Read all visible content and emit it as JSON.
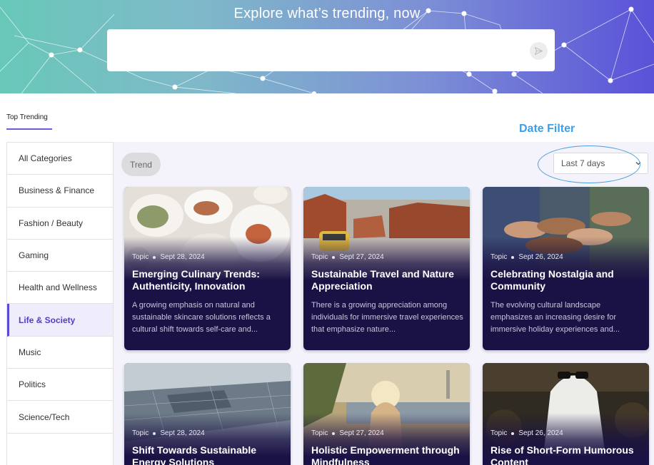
{
  "hero": {
    "title": "Explore what’s trending, now",
    "search_placeholder": "",
    "send_icon": "send-icon"
  },
  "tabs": {
    "top_trending": "Top Trending"
  },
  "annotation": {
    "date_filter": "Date Filter"
  },
  "sidebar": {
    "items": [
      {
        "label": "All Categories"
      },
      {
        "label": "Business & Finance"
      },
      {
        "label": "Fashion / Beauty"
      },
      {
        "label": "Gaming"
      },
      {
        "label": "Health and Wellness"
      },
      {
        "label": "Life & Society",
        "active": true
      },
      {
        "label": "Music"
      },
      {
        "label": "Politics"
      },
      {
        "label": "Science/Tech"
      }
    ]
  },
  "filters": {
    "chip": "Trend",
    "date_selected": "Last 7 days"
  },
  "cards": [
    {
      "topic": "Topic",
      "date": "Sept 28, 2024",
      "title": "Emerging Culinary Trends: Authenticity, Innovation",
      "text": "A growing emphasis on natural and sustainable skincare solutions reflects a cultural shift towards self-care and..."
    },
    {
      "topic": "Topic",
      "date": "Sept 27, 2024",
      "title": "Sustainable Travel and Nature Appreciation",
      "text": "There is a growing appreciation among individuals for immersive travel experiences that emphasize nature..."
    },
    {
      "topic": "Topic",
      "date": "Sept 26, 2024",
      "title": "Celebrating Nostalgia and Community",
      "text": "The evolving cultural landscape emphasizes an increasing desire for immersive holiday experiences and..."
    },
    {
      "topic": "Topic",
      "date": "Sept 28, 2024",
      "title": "Shift Towards Sustainable Energy Solutions",
      "text": ""
    },
    {
      "topic": "Topic",
      "date": "Sept 27, 2024",
      "title": "Holistic Empowerment through Mindfulness",
      "text": ""
    },
    {
      "topic": "Topic",
      "date": "Sept 26, 2024",
      "title": "Rise of Short-Form Humorous Content",
      "text": ""
    }
  ],
  "colors": {
    "accent": "#5b4bd6",
    "card_bg": "#1a1144",
    "annotation": "#3d9ee4"
  }
}
